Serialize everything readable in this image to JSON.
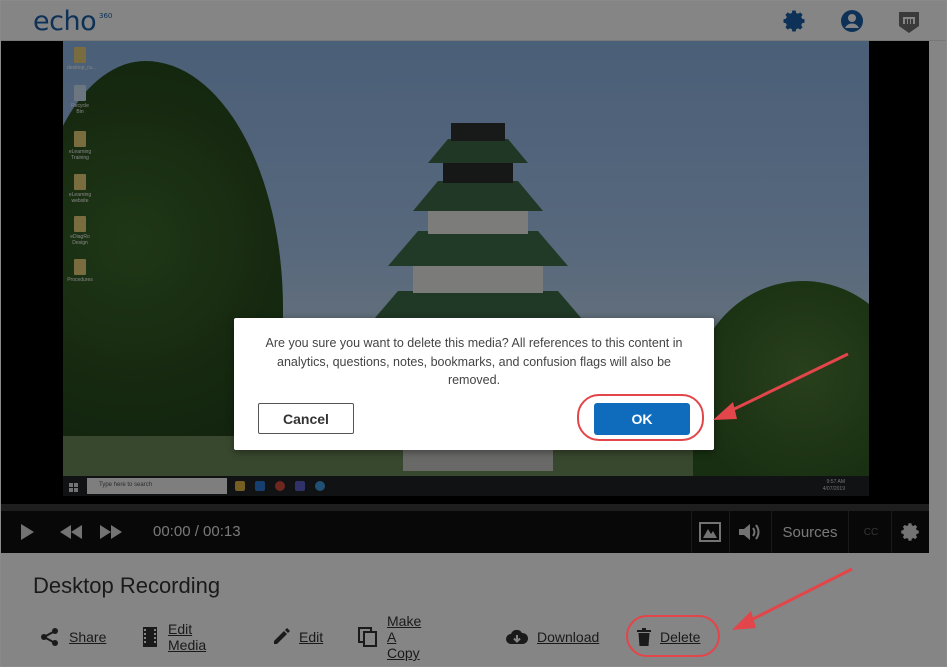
{
  "app": {
    "logo_text": "echo",
    "logo_sup": "360",
    "icons": [
      "settings-gear-icon",
      "user-account-icon",
      "lms-badge-icon"
    ]
  },
  "player": {
    "time_display": "00:00 / 00:13",
    "sources_label": "Sources",
    "cc_label": "CC",
    "desktop": {
      "icons": [
        {
          "label": "desktop_ra..."
        },
        {
          "label": "Recycle Bin"
        },
        {
          "label": "eLearning Training"
        },
        {
          "label": "eLearning website"
        },
        {
          "label": "eDiagRo Design"
        },
        {
          "label": "Procedures"
        }
      ],
      "taskbar_search": "Type here to search",
      "clock_time": "9:57 AM",
      "clock_date": "4/07/2019"
    }
  },
  "media": {
    "title": "Desktop Recording",
    "actions": [
      {
        "label": "Share",
        "icon": "share-icon"
      },
      {
        "label": "Edit Media",
        "icon": "film-strip-icon"
      },
      {
        "label": "Edit",
        "icon": "pencil-icon"
      },
      {
        "label": "Make A Copy",
        "icon": "copy-icon"
      },
      {
        "label": "Download",
        "icon": "cloud-download-icon"
      },
      {
        "label": "Delete",
        "icon": "trash-icon"
      }
    ]
  },
  "dialog": {
    "message": "Are you sure you want to delete this media? All references to this content in analytics, questions, notes, bookmarks, and confusion flags will also be removed.",
    "cancel_label": "Cancel",
    "ok_label": "OK"
  },
  "colors": {
    "brand_blue": "#1a5fa8",
    "ok_button": "#0f6cbd",
    "annotation_red": "#e2454a"
  }
}
